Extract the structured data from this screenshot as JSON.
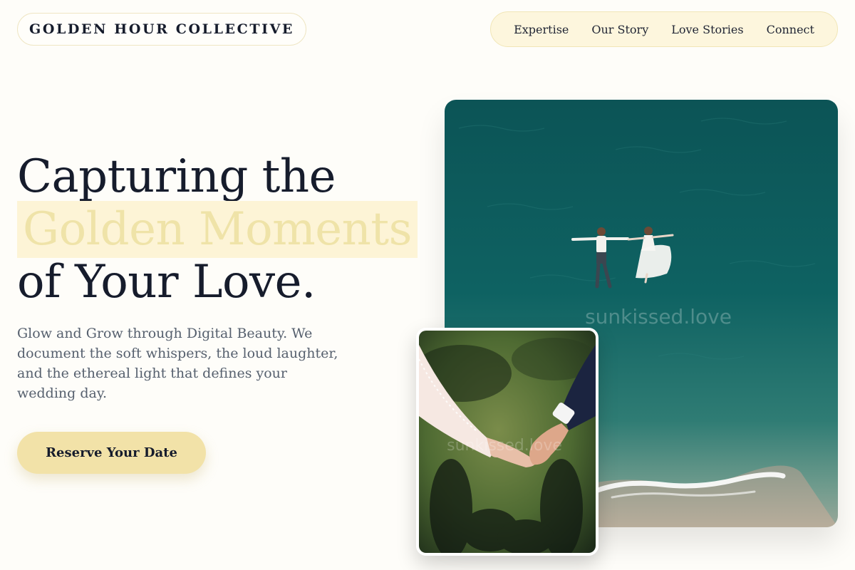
{
  "brand": {
    "name": "GOLDEN HOUR COLLECTIVE"
  },
  "nav": {
    "items": [
      {
        "label": "Expertise"
      },
      {
        "label": "Our Story"
      },
      {
        "label": "Love Stories"
      },
      {
        "label": "Connect"
      }
    ]
  },
  "hero": {
    "title_line1": "Capturing the",
    "title_highlight": "Golden Moments",
    "title_line3": "of Your Love.",
    "description": "Glow and Grow through Digital Beauty. We document the soft whispers, the loud laughter, and the ethereal light that defines your wedding day.",
    "cta_label": "Reserve Your Date"
  },
  "images": {
    "main": {
      "subject": "aerial view of bride and groom floating in turquoise sea",
      "watermark": "sunkissed.love"
    },
    "secondary": {
      "subject": "bride and groom holding hands over green grass with shadows",
      "watermark": "sunkissed.love"
    }
  },
  "colors": {
    "background": "#fefdf9",
    "accent": "#f2e2a8",
    "nav_background": "#fdf6dd",
    "highlight_background": "#fdf4d6",
    "highlight_text": "#efe3a8",
    "heading": "#161c2c",
    "body_text": "#56606e",
    "sea": "#0e5b5b"
  }
}
